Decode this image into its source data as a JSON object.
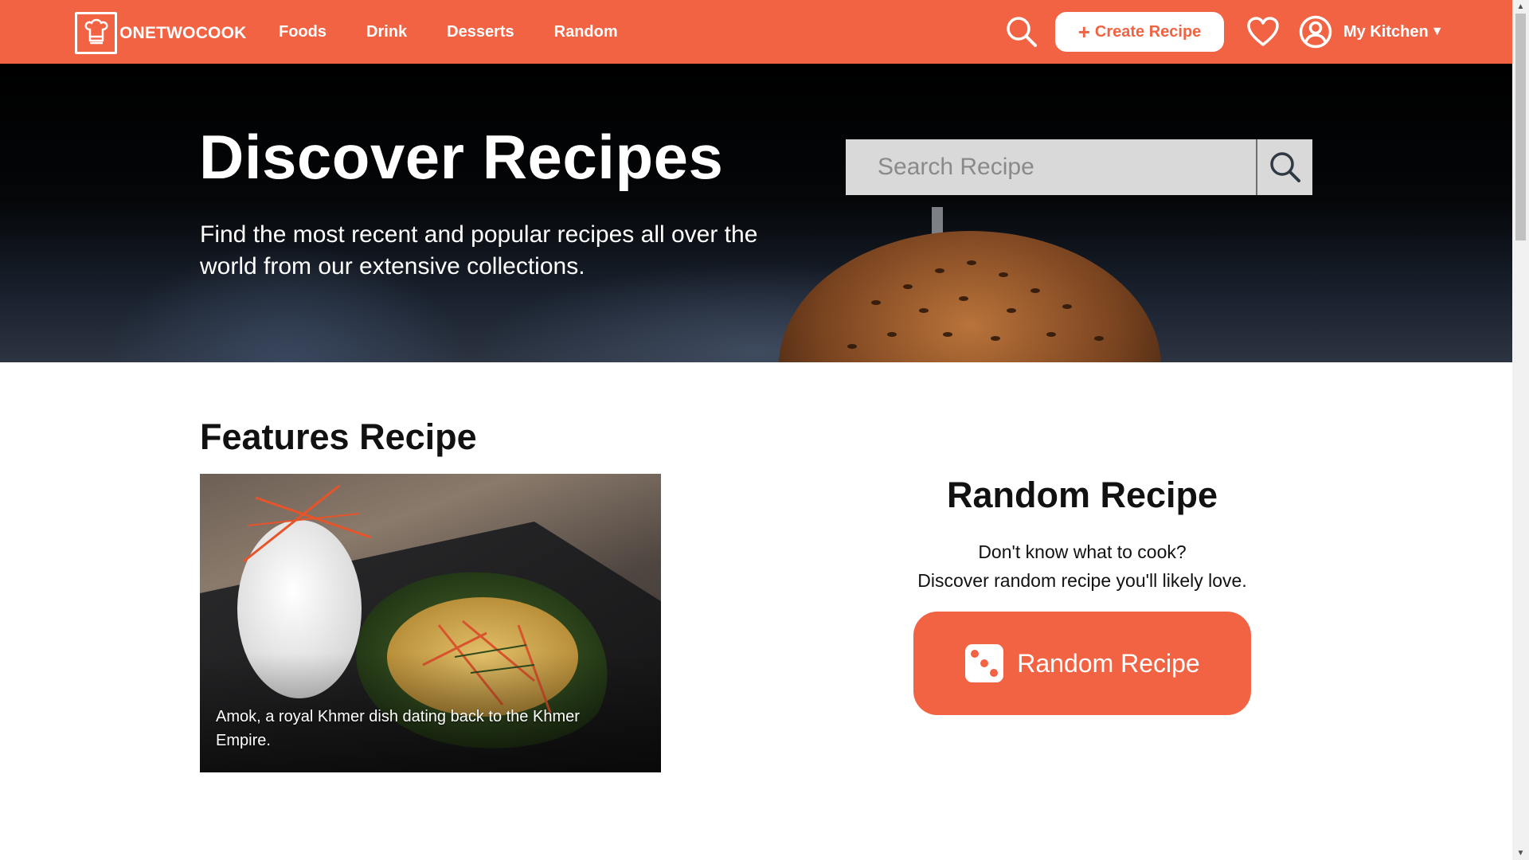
{
  "brand": {
    "name": "ONETWOCOOK",
    "accent": "#f26344"
  },
  "nav": {
    "links": [
      "Foods",
      "Drink",
      "Desserts",
      "Random"
    ],
    "create_label": "Create Recipe",
    "kitchen_label": "My Kitchen"
  },
  "hero": {
    "title": "Discover Recipes",
    "subtitle": "Find the most recent and popular recipes all over the world from our extensive collections.",
    "search_placeholder": "Search Recipe"
  },
  "features": {
    "title": "Features Recipe",
    "caption": "Amok, a royal Khmer dish dating back to the Khmer Empire."
  },
  "random": {
    "title": "Random Recipe",
    "line1": "Don't know what to cook?",
    "line2": "Discover random recipe you'll likely love.",
    "button_label": "Random Recipe"
  },
  "icons": [
    "logo-icon",
    "search-icon",
    "plus-icon",
    "heart-icon",
    "user-icon",
    "chevron-down-icon",
    "dice-icon"
  ]
}
